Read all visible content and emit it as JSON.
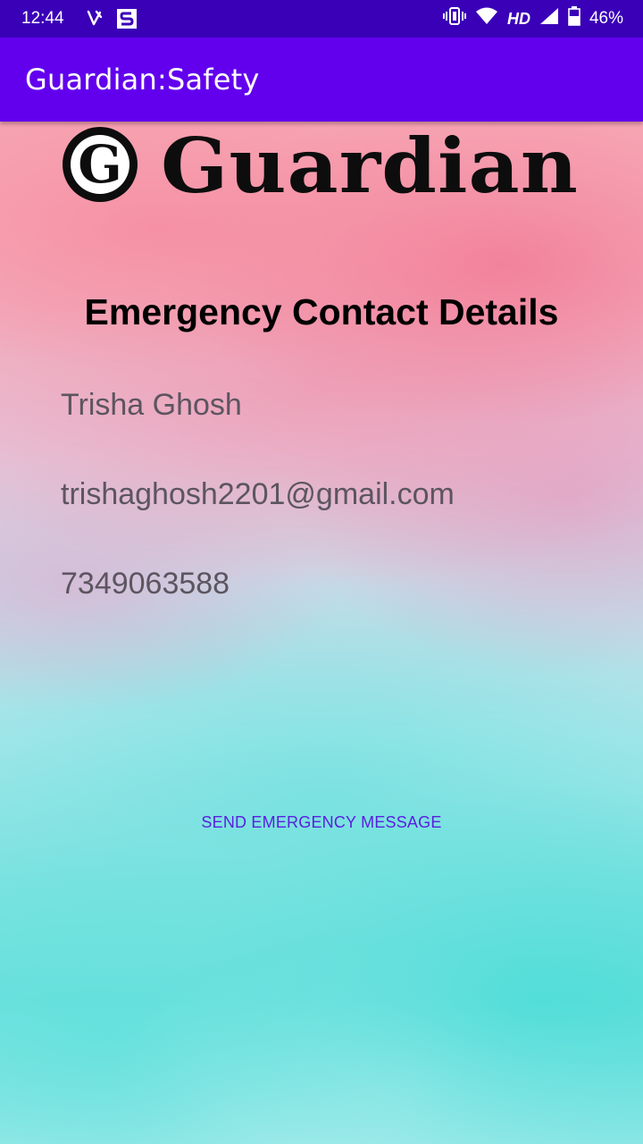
{
  "status_bar": {
    "time": "12:44",
    "network_label": "HD",
    "battery_percent": "46%",
    "icons": [
      "notification-icon",
      "app-s-icon",
      "vibrate-icon",
      "wifi-icon",
      "signal-icon",
      "battery-icon"
    ],
    "background_color": "#3a00b8"
  },
  "app_bar": {
    "title": "Guardian:Safety",
    "background_color": "#6200ee"
  },
  "logo": {
    "mark_letter": "G",
    "wordmark": "Guardian"
  },
  "main": {
    "heading": "Emergency Contact Details",
    "contact": {
      "name": "Trisha Ghosh",
      "email": "trishaghosh2201@gmail.com",
      "phone": "7349063588"
    },
    "send_button_label": "SEND EMERGENCY MESSAGE",
    "accent_color": "#5a1fe0"
  }
}
